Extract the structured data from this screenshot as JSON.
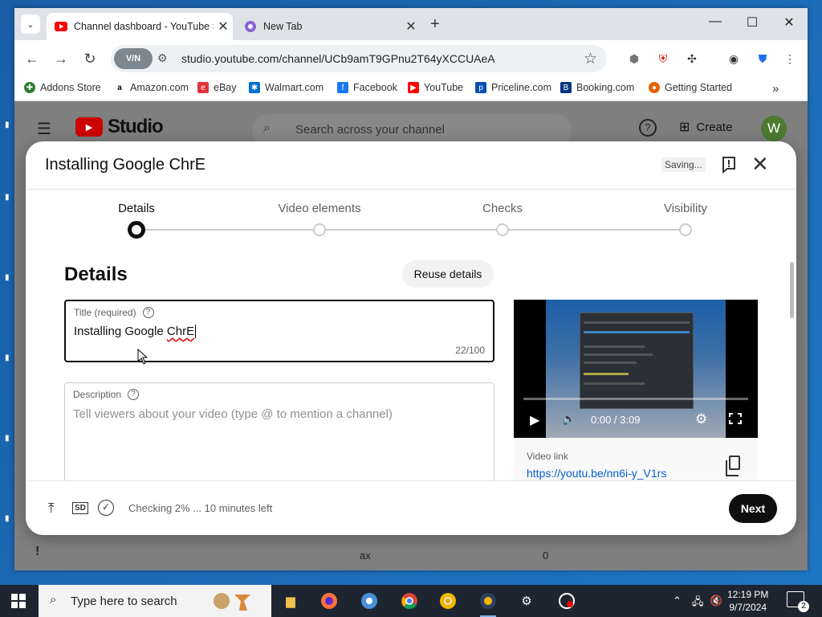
{
  "browser": {
    "tabs": [
      {
        "title": "Channel dashboard - YouTube S",
        "active": true,
        "favicon": "youtube-icon"
      },
      {
        "title": "New Tab",
        "active": false,
        "favicon": "chrome-icon"
      }
    ],
    "url": "studio.youtube.com/channel/UCb9amT9GPnu2T64yXCCUAeA",
    "vpn_label": "V/N",
    "bookmarks": [
      "Addons Store",
      "Amazon.com",
      "eBay",
      "Walmart.com",
      "Facebook",
      "YouTube",
      "Priceline.com",
      "Booking.com",
      "Getting Started"
    ]
  },
  "studio": {
    "logo_text": "Studio",
    "search_placeholder": "Search across your channel",
    "create_label": "Create",
    "avatar_initial": "W",
    "bg_text_1": "ax",
    "bg_text_2": "0"
  },
  "modal": {
    "title": "Installing Google ChrE",
    "saving": "Saving...",
    "steps": [
      "Details",
      "Video elements",
      "Checks",
      "Visibility"
    ],
    "active_step": "Details",
    "section_title": "Details",
    "reuse_label": "Reuse details",
    "title_field": {
      "label": "Title (required)",
      "value_prefix": "Installing Google ",
      "value_flagged": "ChrE",
      "count": "22/100"
    },
    "description_field": {
      "label": "Description",
      "placeholder": "Tell viewers about your video (type @ to mention a channel)"
    },
    "video": {
      "time": "0:00 / 3:09",
      "link_label": "Video link",
      "link": "https://youtu.be/nn6i-y_V1rs"
    },
    "footer": {
      "sd_badge": "SD",
      "status": "Checking 2% ... 10 minutes left",
      "next_label": "Next"
    }
  },
  "taskbar": {
    "search_placeholder": "Type here to search",
    "time": "12:19 PM",
    "date": "9/7/2024",
    "notification_count": "2"
  }
}
